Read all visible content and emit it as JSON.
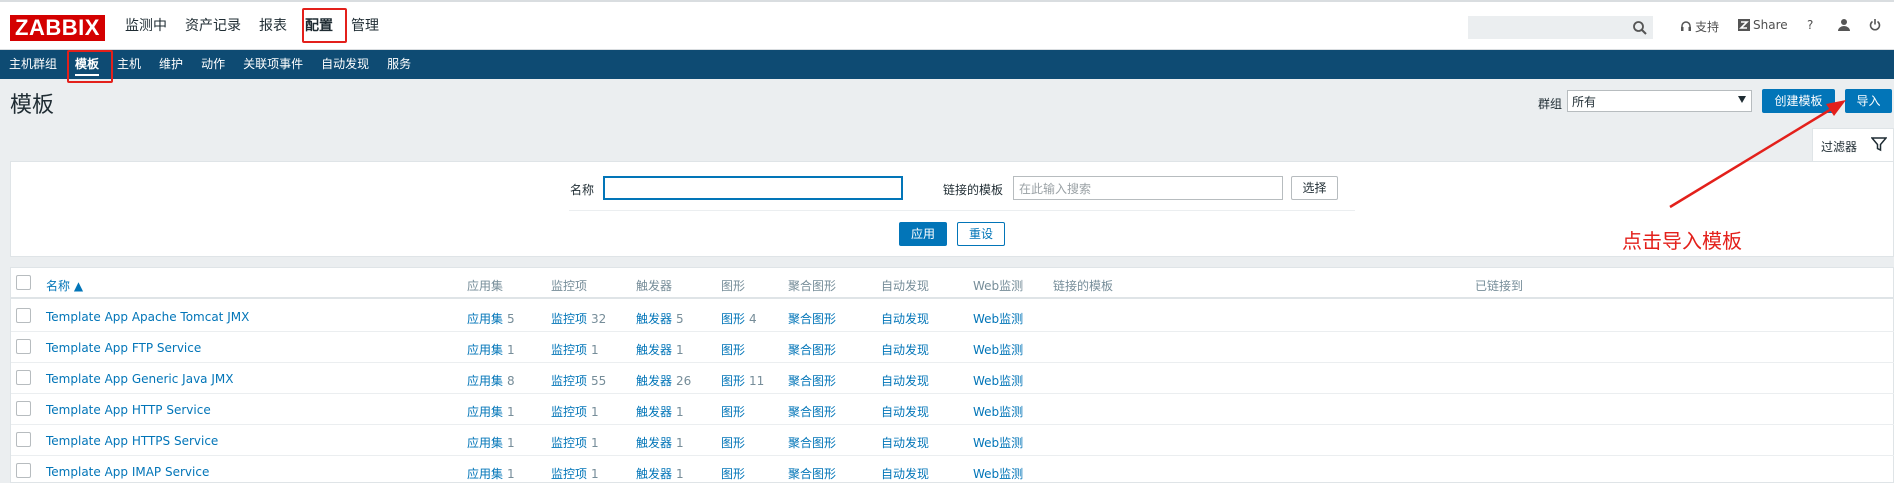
{
  "logo": "ZABBIX",
  "main_nav": [
    "监测中",
    "资产记录",
    "报表",
    "配置",
    "管理"
  ],
  "search": {
    "placeholder": ""
  },
  "tools": {
    "support": "支持",
    "share": "Share",
    "help": "?"
  },
  "sub_nav": [
    "主机群组",
    "模板",
    "主机",
    "维护",
    "动作",
    "关联项事件",
    "自动发现",
    "服务"
  ],
  "page": {
    "title": "模板",
    "group_label": "群组",
    "group_value": "所有",
    "create_button": "创建模板",
    "import_button": "导入"
  },
  "filter": {
    "tab_label": "过滤器",
    "name_label": "名称",
    "name_value": "",
    "linked_label": "链接的模板",
    "linked_placeholder": "在此输入搜索",
    "select_button": "选择",
    "apply_button": "应用",
    "reset_button": "重设"
  },
  "table": {
    "headers": [
      "名称 ▲",
      "应用集",
      "监控项",
      "触发器",
      "图形",
      "聚合图形",
      "自动发现",
      "Web监测",
      "链接的模板",
      "已链接到"
    ],
    "rows": [
      {
        "name": "Template App Apache Tomcat JMX",
        "apps": "应用集",
        "apps_n": "5",
        "items": "监控项",
        "items_n": "32",
        "triggers": "触发器",
        "triggers_n": "5",
        "graphs": "图形",
        "graphs_n": "4",
        "screens": "聚合图形",
        "discovery": "自动发现",
        "web": "Web监测"
      },
      {
        "name": "Template App FTP Service",
        "apps": "应用集",
        "apps_n": "1",
        "items": "监控项",
        "items_n": "1",
        "triggers": "触发器",
        "triggers_n": "1",
        "graphs": "图形",
        "graphs_n": "",
        "screens": "聚合图形",
        "discovery": "自动发现",
        "web": "Web监测"
      },
      {
        "name": "Template App Generic Java JMX",
        "apps": "应用集",
        "apps_n": "8",
        "items": "监控项",
        "items_n": "55",
        "triggers": "触发器",
        "triggers_n": "26",
        "graphs": "图形",
        "graphs_n": "11",
        "screens": "聚合图形",
        "discovery": "自动发现",
        "web": "Web监测"
      },
      {
        "name": "Template App HTTP Service",
        "apps": "应用集",
        "apps_n": "1",
        "items": "监控项",
        "items_n": "1",
        "triggers": "触发器",
        "triggers_n": "1",
        "graphs": "图形",
        "graphs_n": "",
        "screens": "聚合图形",
        "discovery": "自动发现",
        "web": "Web监测"
      },
      {
        "name": "Template App HTTPS Service",
        "apps": "应用集",
        "apps_n": "1",
        "items": "监控项",
        "items_n": "1",
        "triggers": "触发器",
        "triggers_n": "1",
        "graphs": "图形",
        "graphs_n": "",
        "screens": "聚合图形",
        "discovery": "自动发现",
        "web": "Web监测"
      },
      {
        "name": "Template App IMAP Service",
        "apps": "应用集",
        "apps_n": "1",
        "items": "监控项",
        "items_n": "1",
        "triggers": "触发器",
        "triggers_n": "1",
        "graphs": "图形",
        "graphs_n": "",
        "screens": "聚合图形",
        "discovery": "自动发现",
        "web": "Web监测"
      }
    ]
  },
  "annotation": {
    "text": "点击导入模板",
    "color": "#e3201b"
  },
  "colors": {
    "brand": "#d40000",
    "subnav": "#0e4b73",
    "accent": "#0275b8"
  }
}
